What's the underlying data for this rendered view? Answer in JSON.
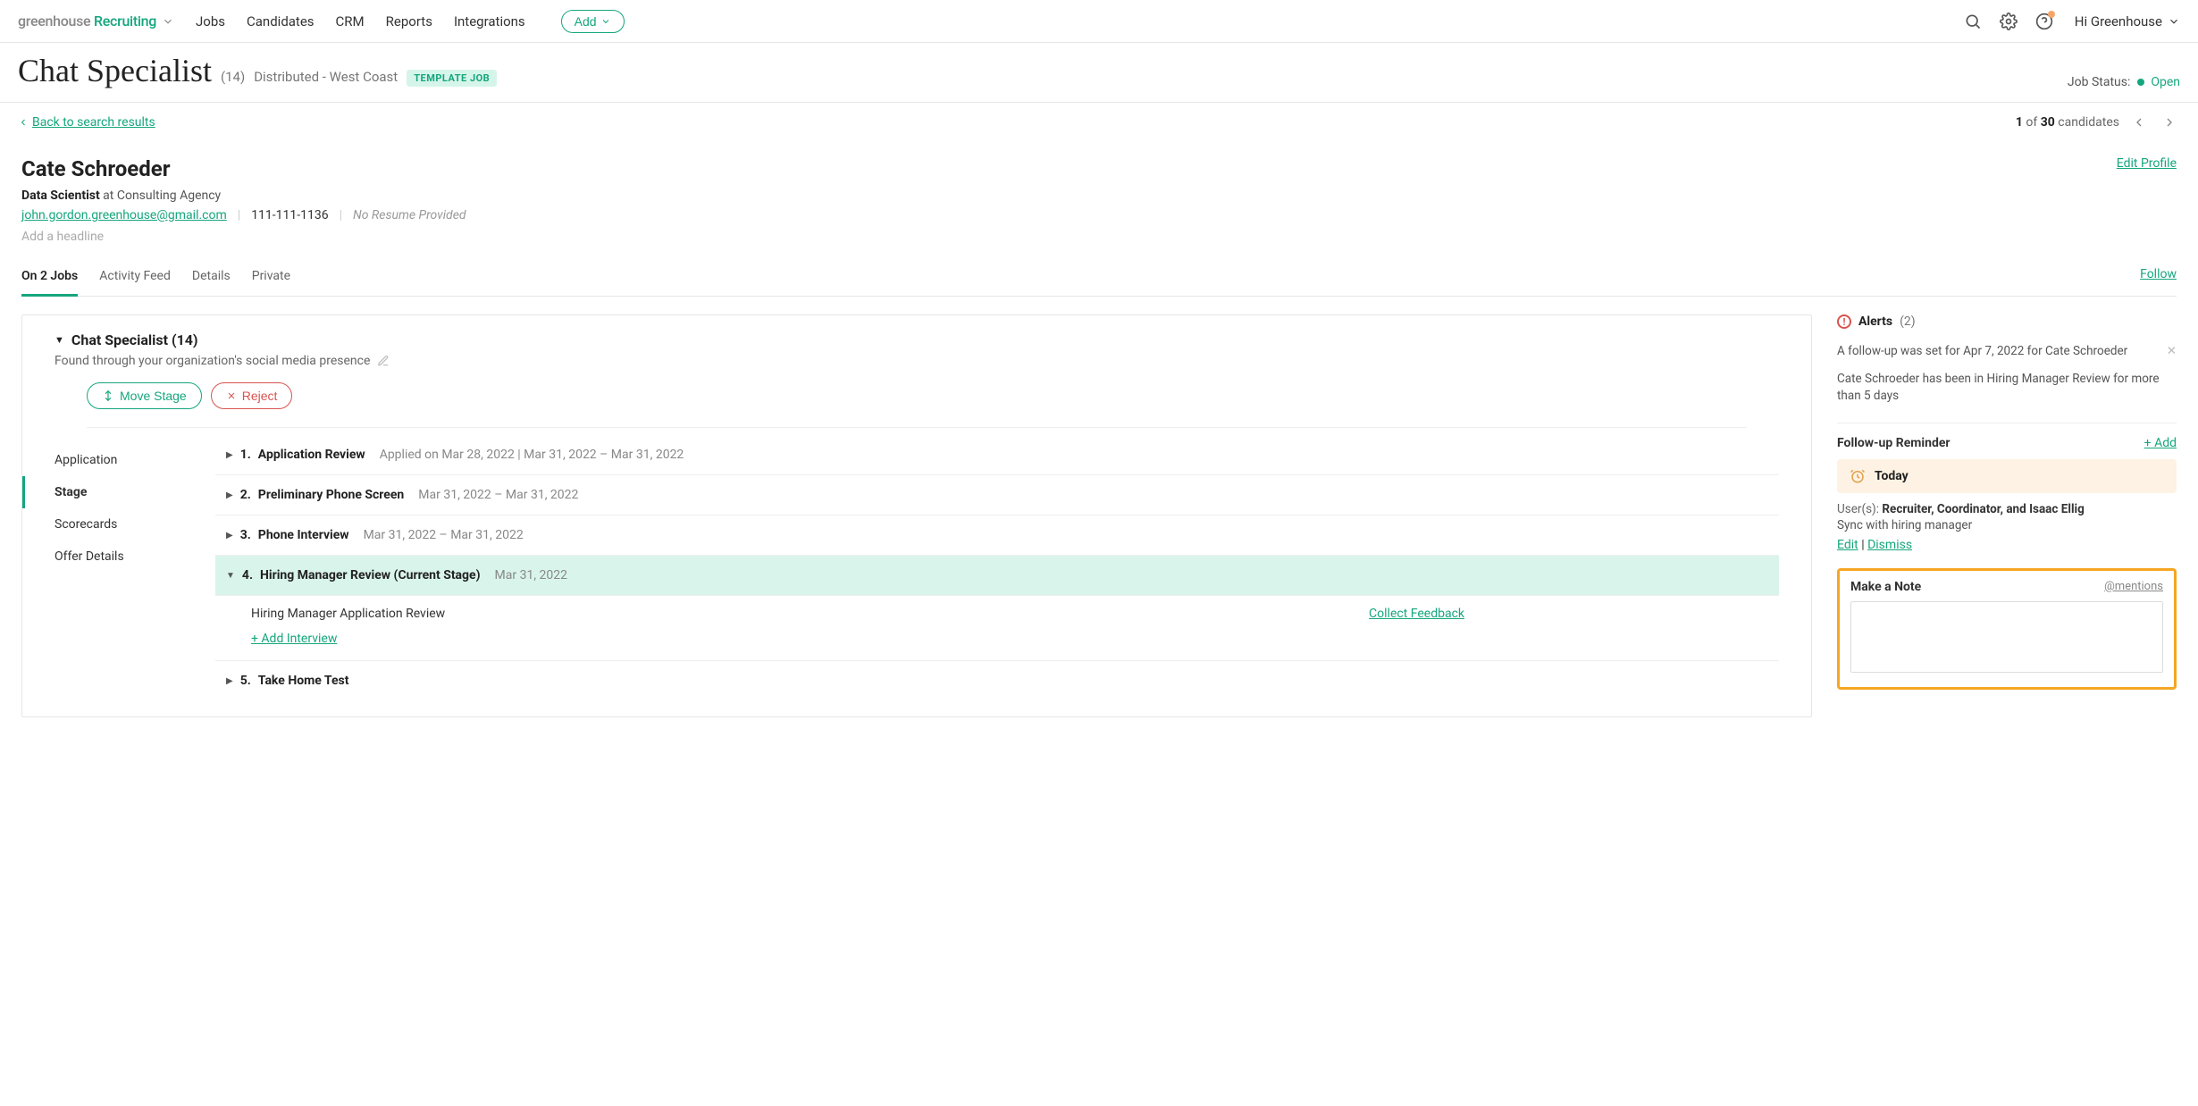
{
  "nav": {
    "logo_grey": "greenhouse",
    "logo_green": " Recruiting",
    "links": [
      "Jobs",
      "Candidates",
      "CRM",
      "Reports",
      "Integrations"
    ],
    "add": "Add",
    "greeting": "Hi Greenhouse"
  },
  "job": {
    "title": "Chat Specialist",
    "count": "(14)",
    "location": "Distributed - West Coast",
    "template_badge": "TEMPLATE JOB",
    "status_label": "Job Status:",
    "status_value": "Open"
  },
  "back": {
    "label": "Back to search results",
    "pager_pos": "1",
    "pager_of": "of",
    "pager_total": "30",
    "pager_noun": "candidates"
  },
  "candidate": {
    "name": "Cate Schroeder",
    "edit": "Edit Profile",
    "role_title": "Data Scientist",
    "role_at": " at Consulting Agency",
    "email": "john.gordon.greenhouse@gmail.com",
    "phone": "111-111-1136",
    "no_resume": "No Resume Provided",
    "headline_ph": "Add a headline"
  },
  "tabs": {
    "items": [
      "On 2 Jobs",
      "Activity Feed",
      "Details",
      "Private"
    ],
    "follow": "Follow"
  },
  "card": {
    "title": "Chat Specialist (14)",
    "source": "Found through your organization's social media presence",
    "move": "Move Stage",
    "reject": "Reject",
    "nav": [
      "Application",
      "Stage",
      "Scorecards",
      "Offer Details"
    ],
    "stages": [
      {
        "num": "1.",
        "name": "Application Review",
        "dates": "Applied on Mar 28, 2022 | Mar 31, 2022 – Mar 31, 2022"
      },
      {
        "num": "2.",
        "name": "Preliminary Phone Screen",
        "dates": "Mar 31, 2022 – Mar 31, 2022"
      },
      {
        "num": "3.",
        "name": "Phone Interview",
        "dates": "Mar 31, 2022 – Mar 31, 2022"
      },
      {
        "num": "4.",
        "name": "Hiring Manager Review (Current Stage)",
        "dates": "Mar 31, 2022"
      },
      {
        "num": "5.",
        "name": "Take Home Test",
        "dates": ""
      }
    ],
    "detail_title": "Hiring Manager Application Review",
    "collect": "Collect Feedback",
    "add_interview": "+ Add Interview"
  },
  "alerts": {
    "label": "Alerts",
    "count": "(2)",
    "items": [
      "A follow-up was set for Apr 7, 2022 for Cate Schroeder",
      "Cate Schroeder has been in Hiring Manager Review for more than 5 days"
    ]
  },
  "followup": {
    "label": "Follow-up Reminder",
    "add": "+ Add",
    "today": "Today",
    "users_label": "User(s): ",
    "users": "Recruiter, Coordinator, and Isaac Ellig",
    "sync": "Sync with hiring manager",
    "edit": "Edit",
    "dismiss": "Dismiss"
  },
  "note": {
    "label": "Make a Note",
    "mentions": "@mentions"
  }
}
